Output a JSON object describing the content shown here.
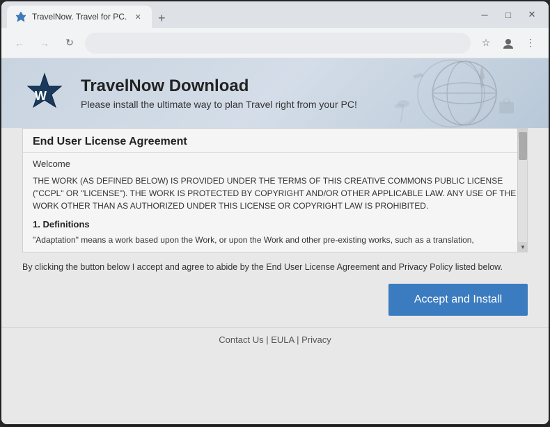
{
  "browser": {
    "tab_title": "TravelNow. Travel for PC.",
    "window_controls": {
      "minimize": "─",
      "maximize": "□",
      "close": "✕"
    },
    "nav": {
      "back_disabled": true,
      "forward_disabled": true
    },
    "address_placeholder": ""
  },
  "header": {
    "title": "TravelNow Download",
    "subtitle": "Please install the ultimate way to plan Travel right from your PC!"
  },
  "eula": {
    "title": "End User License Agreement",
    "welcome_label": "Welcome",
    "body_text": "THE WORK (AS DEFINED BELOW) IS PROVIDED UNDER THE TERMS OF THIS CREATIVE COMMONS PUBLIC LICENSE (\"CCPL\" OR \"LICENSE\"). THE WORK IS PROTECTED BY COPYRIGHT AND/OR OTHER APPLICABLE LAW. ANY USE OF THE WORK OTHER THAN AS AUTHORIZED UNDER THIS LICENSE OR COPYRIGHT LAW IS PROHIBITED.",
    "section_title": "1. Definitions",
    "definition_text": "\"Adaptation\" means a work based upon the Work, or upon the Work and other pre-existing works, such as a translation,"
  },
  "agreement": {
    "text": "By clicking the button below I accept and agree to abide by the End User License Agreement and Privacy Policy listed below."
  },
  "button": {
    "accept_label": "Accept and Install"
  },
  "footer": {
    "links": [
      "Contact Us",
      "EULA",
      "Privacy"
    ]
  }
}
